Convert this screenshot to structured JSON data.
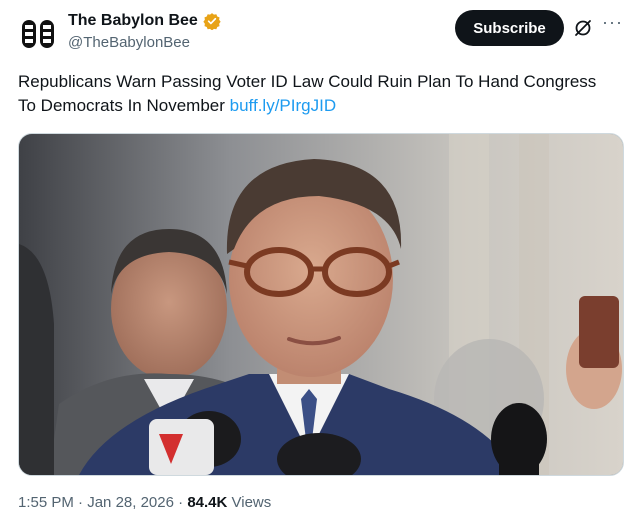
{
  "account": {
    "name": "The Babylon Bee",
    "handle": "@TheBabylonBee",
    "verified_color": "#e8a317"
  },
  "actions": {
    "subscribe_label": "Subscribe"
  },
  "tweet": {
    "text": "Republicans Warn Passing Voter ID Law Could Ruin Plan To Hand Congress To Democrats In November",
    "link": "buff.ly/PIrgJID"
  },
  "meta": {
    "time": "1:55 PM",
    "separator": "·",
    "date": "Jan 28, 2026",
    "views_count": "84.4K",
    "views_label": "Views"
  },
  "colors": {
    "link": "#1d9bf0",
    "button_bg": "#0f1419",
    "secondary_text": "#536471"
  }
}
